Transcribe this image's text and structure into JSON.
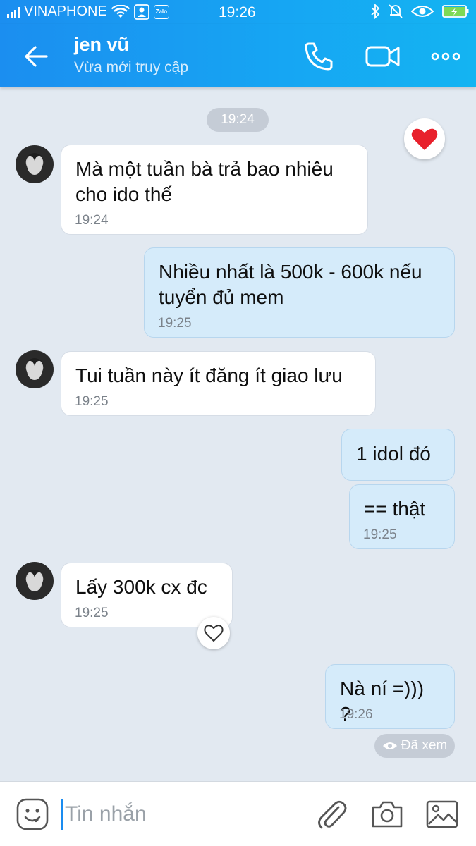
{
  "status_bar": {
    "carrier": "VINAPHONE",
    "time": "19:26",
    "app_badge": "Zalo"
  },
  "header": {
    "title": "jen vũ",
    "subtitle": "Vừa mới truy cập"
  },
  "chat": {
    "time_divider": "19:24",
    "messages": [
      {
        "direction": "in",
        "text": "Mà một tuần bà trả bao nhiêu cho ido thế",
        "time": "19:24"
      },
      {
        "direction": "out",
        "text": "Nhiều nhất là 500k - 600k nếu tuyển đủ mem",
        "time": "19:25"
      },
      {
        "direction": "in",
        "text": "Tui tuần này ít đăng ít giao lưu",
        "time": "19:25"
      },
      {
        "direction": "out",
        "text": "1 idol đó",
        "time": ""
      },
      {
        "direction": "out",
        "text": "== thật",
        "time": "19:25"
      },
      {
        "direction": "in",
        "text": "Lấy 300k cx đc",
        "time": "19:25"
      },
      {
        "direction": "out",
        "text": "Nà ní =))) ?",
        "time": "19:26"
      }
    ],
    "seen_label": "Đã xem"
  },
  "input": {
    "placeholder": "Tin nhắn"
  },
  "colors": {
    "header": "#1b8ef0",
    "incoming_bubble": "#ffffff",
    "outgoing_bubble": "#d5ebfa",
    "chat_bg": "#e2e9f1",
    "heart": "#e8212c"
  }
}
